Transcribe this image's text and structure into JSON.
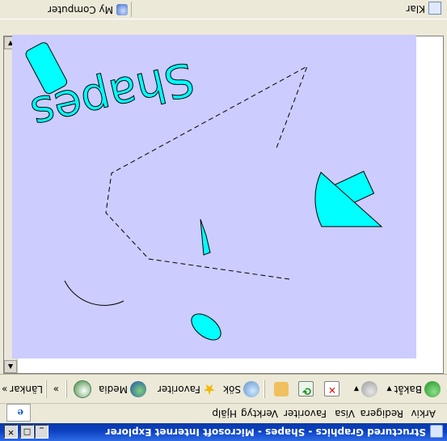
{
  "window": {
    "title": "Structured Graphics - Shapes - Microsoft Internet Explorer",
    "controls": {
      "minimize": "_",
      "maximize": "□",
      "close": "✕"
    }
  },
  "menu": {
    "items": [
      "Arkiv",
      "Redigera",
      "Visa",
      "Favoriter",
      "Verktyg",
      "Hjälp"
    ],
    "brand": "e"
  },
  "toolbar": {
    "back_label": "Bakåt",
    "search_label": "Sök",
    "favorites_label": "Favoriter",
    "media_label": "Media",
    "overflow": "»",
    "links_label": "Länkar",
    "links_overflow": "»",
    "dropdown_arrow": "▼",
    "icons": [
      "back-arrow",
      "forward-arrow",
      "stop",
      "refresh",
      "home",
      "search",
      "favorites-star",
      "media",
      "history"
    ]
  },
  "page": {
    "background": "#ffffff",
    "canvas_color": "#ccccff",
    "shape_fill": "#00ffff",
    "heading": "Shapes"
  },
  "scrollbar": {
    "up": "▲",
    "down": "▼"
  },
  "status": {
    "text": "Klar",
    "zone": "My Computer"
  }
}
